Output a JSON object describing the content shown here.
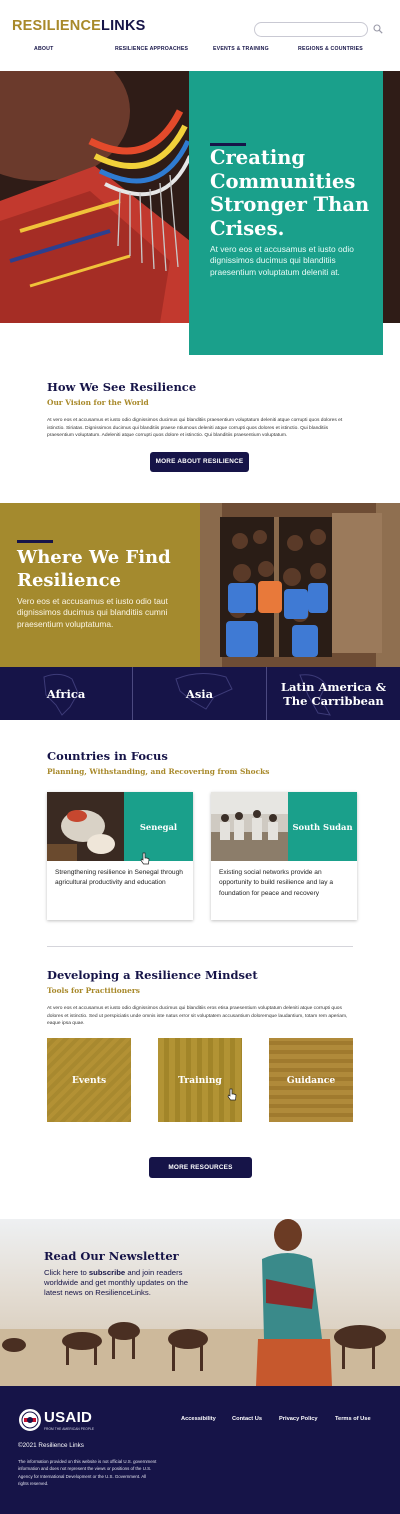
{
  "header": {
    "logo_part1": "RESILIENCE",
    "logo_part2": "LINKS",
    "nav": [
      "ABOUT",
      "RESILIENCE APPROACHES",
      "EVENTS & TRAINING",
      "REGIONS & COUNTRIES"
    ],
    "search_placeholder": ""
  },
  "hero": {
    "title": "Creating Communities Stronger Than Crises.",
    "text": "At vero eos et accusamus et iusto odio dignissimos ducimus qui blanditiis praesentium voluptatum deleniti at."
  },
  "vision": {
    "title": "How We See Resilience",
    "subtitle": "Our Vision for the World",
    "body": "At vero eos et accusamus et iusto odio dignissimos ducimus qui blanditiis praesentium voluptatum deleniti atque corrupti quos dolores et istinctio. Siriatas. Dignissimos ducimus qui blanditiis praese ntiumous deleniti atque corrupti quos dolores et istinctio. Qui blanditiis praesentium voluptatum. Adeleniti atque corrupti quos dolore et istinctio. Qui blanditiis praesentium voluptatum.",
    "button": "MORE ABOUT RESILIENCE"
  },
  "where": {
    "title": "Where We Find Resilience",
    "text": "Vero eos et accusamus et iusto odio taut dignissimos ducimus qui blanditiis cumni praesentium voluptatuma."
  },
  "regions": [
    "Africa",
    "Asia",
    "Latin America & The Carribbean"
  ],
  "countries": {
    "title": "Countries in Focus",
    "subtitle": "Planning, Withstanding, and Recovering from Shocks",
    "cards": [
      {
        "name": "Senegal",
        "text": "Strengthening resilience in Senegal through agricultural productivity and education"
      },
      {
        "name": "South Sudan",
        "text": "Existing social networks provide an opportunity to build resilience and lay a foundation for peace and recovery"
      }
    ]
  },
  "mindset": {
    "title": "Developing a Resilience Mindset",
    "subtitle": "Tools for Practitioners",
    "body": "At vero eos et accusamus et iusto odio dignissimos ducimus qui blanditiis eros etisa praesentium voluptatum deleniti atque corrupti quos dolores et istinctio. Sed ut perspiciatis unde omnis iste natus error sit voluptatem accusantium doloremque laudantium, totam rem aperiam, eaque ipsa quae.",
    "tiles": [
      "Events",
      "Training",
      "Guidance"
    ],
    "button": "MORE RESOURCES"
  },
  "newsletter": {
    "title": "Read Our Newsletter",
    "text_before": "Click here to ",
    "text_link": "subscribe",
    "text_after": " and join readers worldwide and get monthly updates on the latest news on ResilienceLinks."
  },
  "footer": {
    "logo_word": "USAID",
    "logo_tagline": "FROM THE AMERICAN PEOPLE",
    "links": [
      "Accessibility",
      "Contact Us",
      "Privacy Policy",
      "Terms of Use"
    ],
    "copyright": "©2021 Resilience Links",
    "disclaimer": "The information provided on this website is not official U.S. government information and does not represent the views or positions of the U.S. Agency for International Development or the U.S. Government. All rights reserved."
  },
  "colors": {
    "navy": "#161448",
    "teal": "#1aa08b",
    "gold": "#a48a2e"
  }
}
